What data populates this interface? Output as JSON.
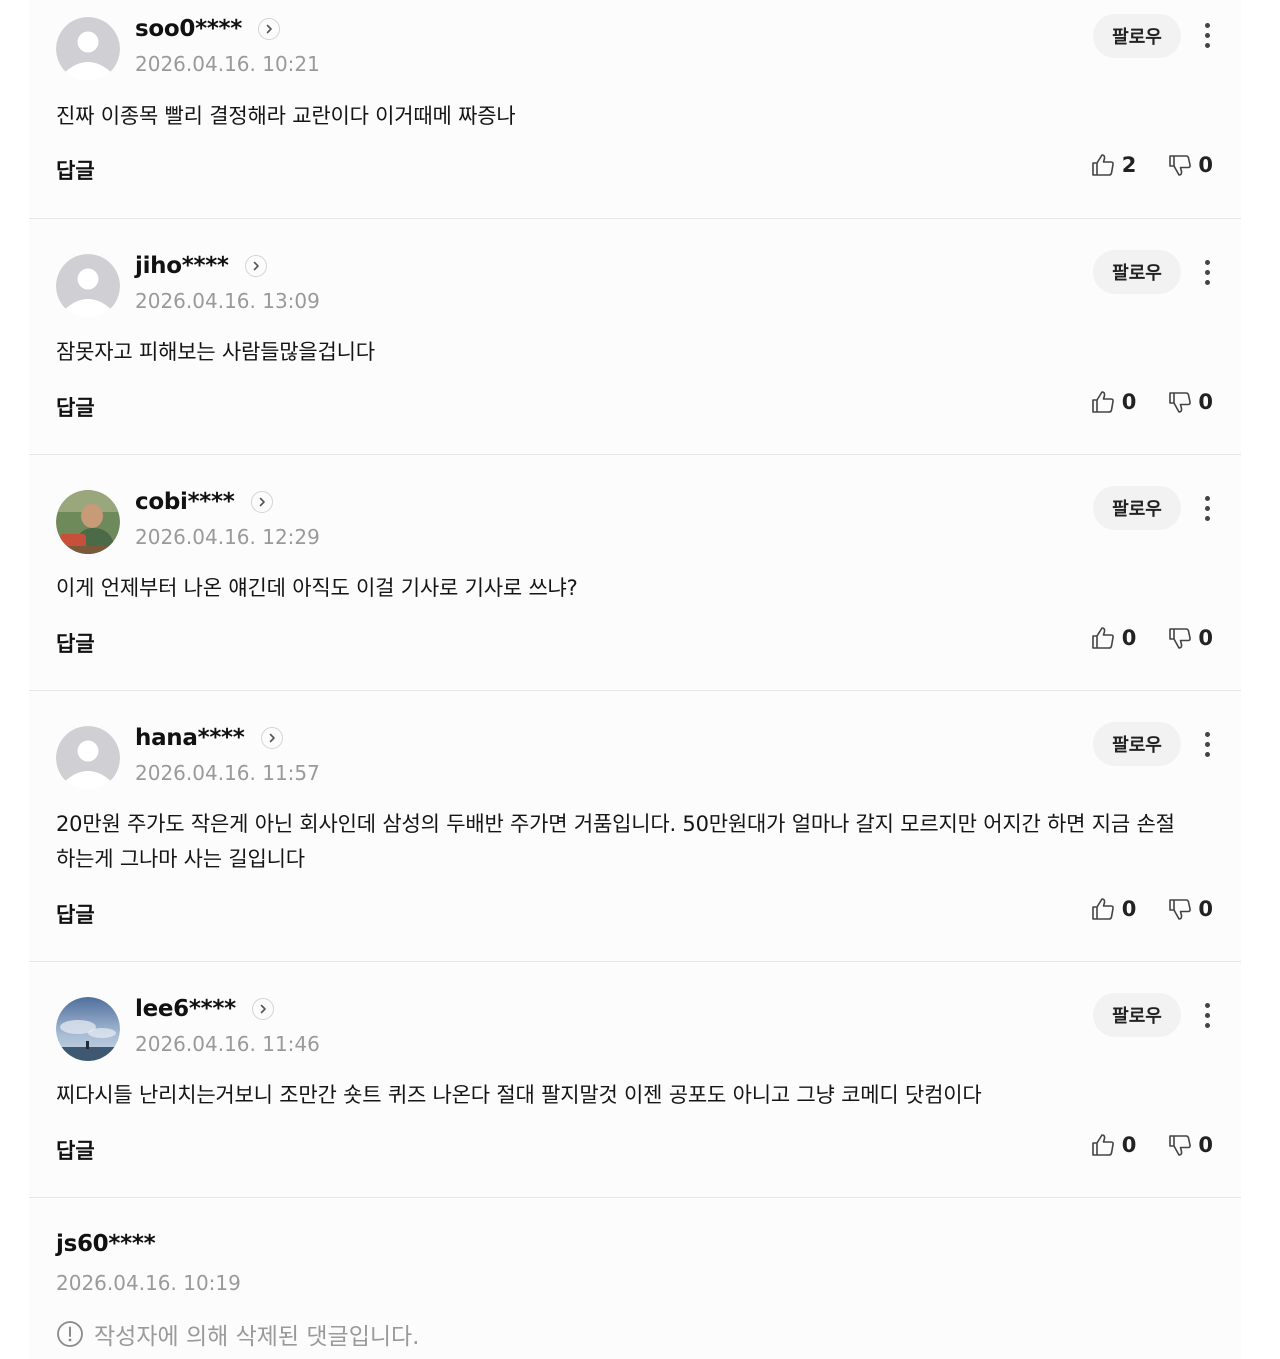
{
  "comments": [
    {
      "nickname": "soo0****",
      "date": "2026.04.16. 10:21",
      "text": "진짜 이종목 빨리 결정해라 교란이다 이거때메 짜증나",
      "likes": "2",
      "dislikes": "0",
      "avatar": "default-avatar-icon"
    },
    {
      "nickname": "jiho****",
      "date": "2026.04.16. 13:09",
      "text": "잠못자고 피해보는 사람들많을겁니다",
      "likes": "0",
      "dislikes": "0",
      "avatar": "default-avatar-icon"
    },
    {
      "nickname": "cobi****",
      "date": "2026.04.16. 12:29",
      "text": "이게 언제부터 나온 얘긴데 아직도 이걸 기사로 기사로 쓰냐?",
      "likes": "0",
      "dislikes": "0",
      "avatar": "photo-avatar"
    },
    {
      "nickname": "hana****",
      "date": "2026.04.16. 11:57",
      "text": "20만원 주가도 작은게 아닌 회사인데 삼성의 두배반 주가면 거품입니다. 50만원대가 얼마나 갈지 모르지만 어지간 하면 지금 손절하는게 그나마 사는 길입니다",
      "likes": "0",
      "dislikes": "0",
      "avatar": "default-avatar-icon"
    },
    {
      "nickname": "lee6****",
      "date": "2026.04.16. 11:46",
      "text": "찌다시들 난리치는거보니 조만간 숏트 퀴즈 나온다 절대 팔지말것 이젠 공포도 아니고 그냥 코메디 닷컴이다",
      "likes": "0",
      "dislikes": "0",
      "avatar": "photo-avatar"
    }
  ],
  "labels": {
    "follow": "팔로우",
    "reply": "답글"
  },
  "deleted_comment": {
    "nickname": "js60****",
    "date": "2026.04.16. 10:19",
    "notice": "작성자에 의해 삭제된 댓글입니다."
  },
  "colors": {
    "date_gray": "#9a9a9a",
    "follow_bg": "#f2f2f2",
    "divider": "#e6e6e6"
  }
}
